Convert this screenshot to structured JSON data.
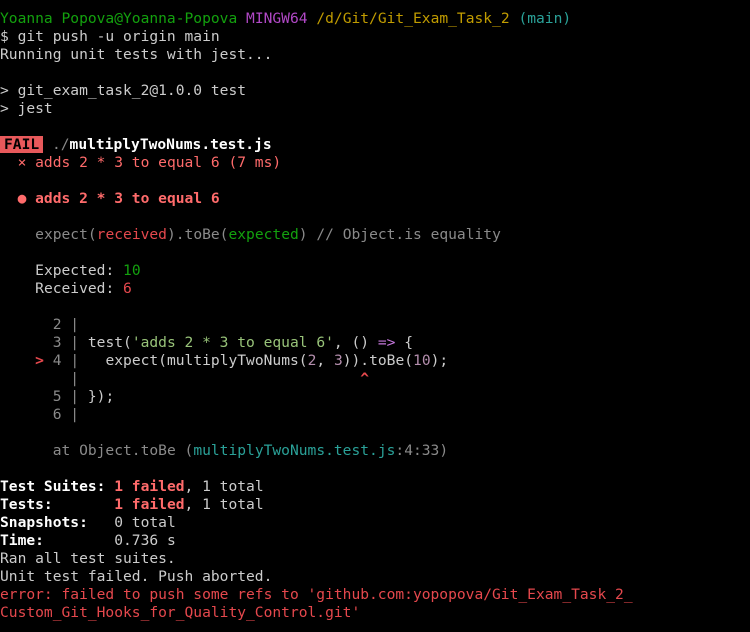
{
  "prompt": {
    "user_host": "Yoanna Popova@Yoanna-Popova",
    "shell": "MINGW64",
    "path": "/d/Git/Git_Exam_Task_2",
    "branch": "(main)"
  },
  "command": "$ git push -u origin main",
  "running": "Running unit tests with jest...",
  "npm_script": "> git_exam_task_2@1.0.0 test",
  "npm_cmd": "> jest",
  "fail_badge": "FAIL",
  "test_file_dir": "./",
  "test_file_name": "multiplyTwoNums.test.js",
  "failed_case": "× adds 2 * 3 to equal 6 (7 ms)",
  "failure_title": "● adds 2 * 3 to equal 6",
  "expect_line": {
    "a": "expect(",
    "received": "received",
    "b": ").toBe(",
    "expected": "expected",
    "c": ") // Object.is equality"
  },
  "expected_label": "Expected: ",
  "expected_value": "10",
  "received_label": "Received: ",
  "received_value": "6",
  "code": {
    "l2": "2 |",
    "l3_num": "3 |",
    "l3_a": "test(",
    "l3_str": "'adds 2 * 3 to equal 6'",
    "l3_b": ", () ",
    "l3_arrow": "=>",
    "l3_c": " {",
    "l4_marker": ">",
    "l4_num": "4 |",
    "l4_a": "expect(multiplyTwoNums(",
    "l4_n1": "2",
    "l4_b": ", ",
    "l4_n2": "3",
    "l4_c": ")).toBe(",
    "l4_n3": "10",
    "l4_d": ");",
    "caret_bar": "|",
    "caret": "^",
    "l5_num": "5 |",
    "l5_code": "});",
    "l6_num": "6 |"
  },
  "stack": {
    "at": "at Object.toBe (",
    "file": "multiplyTwoNums.test.js",
    "pos": ":4:33)"
  },
  "summary": {
    "suites_label": "Test Suites: ",
    "suites_failed": "1 failed",
    "suites_total": ", 1 total",
    "tests_label": "Tests:       ",
    "tests_failed": "1 failed",
    "tests_total": ", 1 total",
    "snapshots_label": "Snapshots:   ",
    "snapshots_value": "0 total",
    "time_label": "Time:        ",
    "time_value": "0.736 s",
    "ran_all": "Ran all test suites."
  },
  "hook_msg": "Unit test failed. Push aborted.",
  "error_line1": "error: failed to push some refs to 'github.com:yopopova/Git_Exam_Task_2_",
  "error_line2": "Custom_Git_Hooks_for_Quality_Control.git'"
}
